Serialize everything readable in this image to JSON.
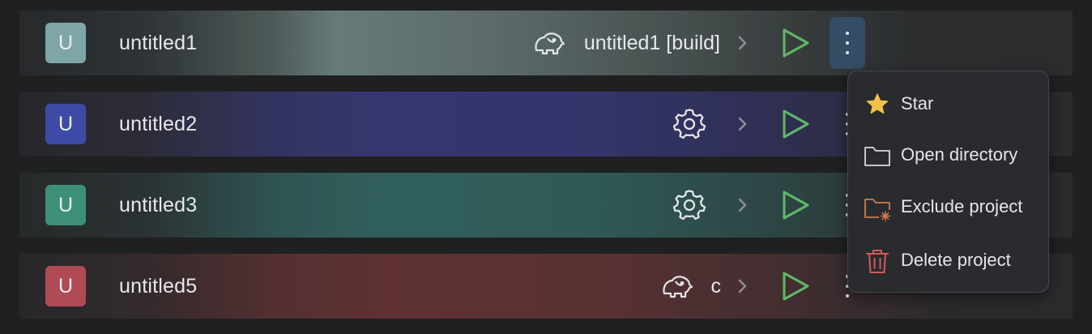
{
  "projects": [
    {
      "initial": "U",
      "name": "untitled1",
      "config_icon": "elephant-icon",
      "config_label": "untitled1 [build]",
      "avatar_color": "#7fa6a6",
      "row_tint": "#6a7f7c"
    },
    {
      "initial": "U",
      "name": "untitled2",
      "config_icon": "gear-icon",
      "config_label": "",
      "avatar_color": "#3e4ba6",
      "row_tint": "#343468"
    },
    {
      "initial": "U",
      "name": "untitled3",
      "config_icon": "gear-icon",
      "config_label": "",
      "avatar_color": "#3d8f78",
      "row_tint": "#305d5a"
    },
    {
      "initial": "U",
      "name": "untitled5",
      "config_icon": "elephant-icon",
      "config_label": "c",
      "avatar_color": "#b04a55",
      "row_tint": "#5e3032"
    }
  ],
  "context_menu": {
    "items": [
      {
        "label": "Star",
        "icon": "star-icon"
      },
      {
        "label": "Open directory",
        "icon": "folder-icon"
      },
      {
        "label": "Exclude project",
        "icon": "folder-exclude-icon"
      },
      {
        "label": "Delete project",
        "icon": "trash-icon"
      }
    ]
  },
  "colors": {
    "background": "#1f2022",
    "play": "#5fb865",
    "kebab_active": "#344d65",
    "star": "#f2c14b",
    "exclude": "#d07c4c",
    "delete": "#d15a5a"
  }
}
